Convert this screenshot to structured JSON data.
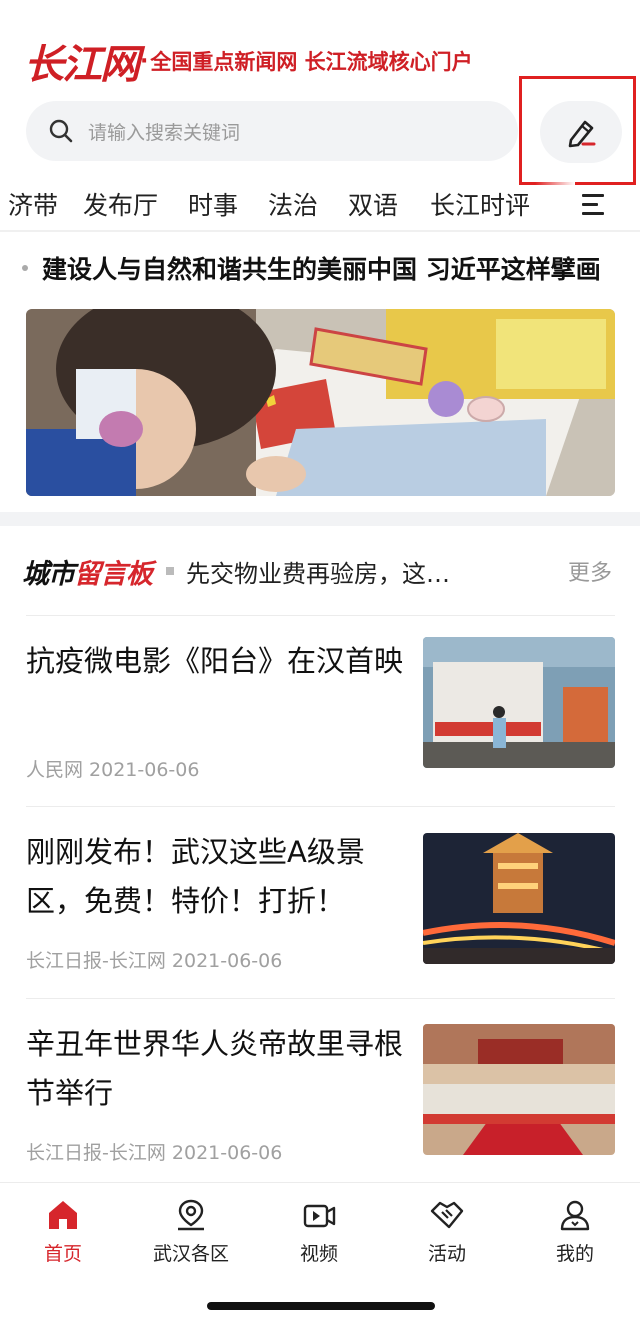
{
  "header": {
    "brand": "长江网",
    "slogan": "全国重点新闻网 长江流域核心门户",
    "search_placeholder": "请输入搜索关键词"
  },
  "tabs": [
    "济带",
    "发布厅",
    "时事",
    "法治",
    "双语",
    "长江时评"
  ],
  "headline": {
    "text": "建设人与自然和谐共生的美丽中国 习近平这样擘画"
  },
  "board": {
    "logo_part1": "城市",
    "logo_part2": "留言板",
    "text": "先交物业费再验房，这…",
    "more": "更多"
  },
  "news": [
    {
      "title": "抗疫微电影《阳台》在汉首映",
      "meta": "人民网 2021-06-06"
    },
    {
      "title": "刚刚发布！武汉这些A级景区，免费！特价！打折！",
      "meta": "长江日报-长江网 2021-06-06"
    },
    {
      "title": "辛丑年世界华人炎帝故里寻根节举行",
      "meta": "长江日报-长江网 2021-06-06"
    }
  ],
  "bottom_nav": [
    {
      "label": "首页",
      "icon": "home-icon",
      "active": true
    },
    {
      "label": "武汉各区",
      "icon": "location-icon",
      "active": false
    },
    {
      "label": "视频",
      "icon": "video-icon",
      "active": false
    },
    {
      "label": "活动",
      "icon": "handshake-icon",
      "active": false
    },
    {
      "label": "我的",
      "icon": "user-icon",
      "active": false
    }
  ],
  "colors": {
    "brand_red": "#cf1f25",
    "highlight_red": "#e02020",
    "meta_gray": "#a0a0a0"
  }
}
